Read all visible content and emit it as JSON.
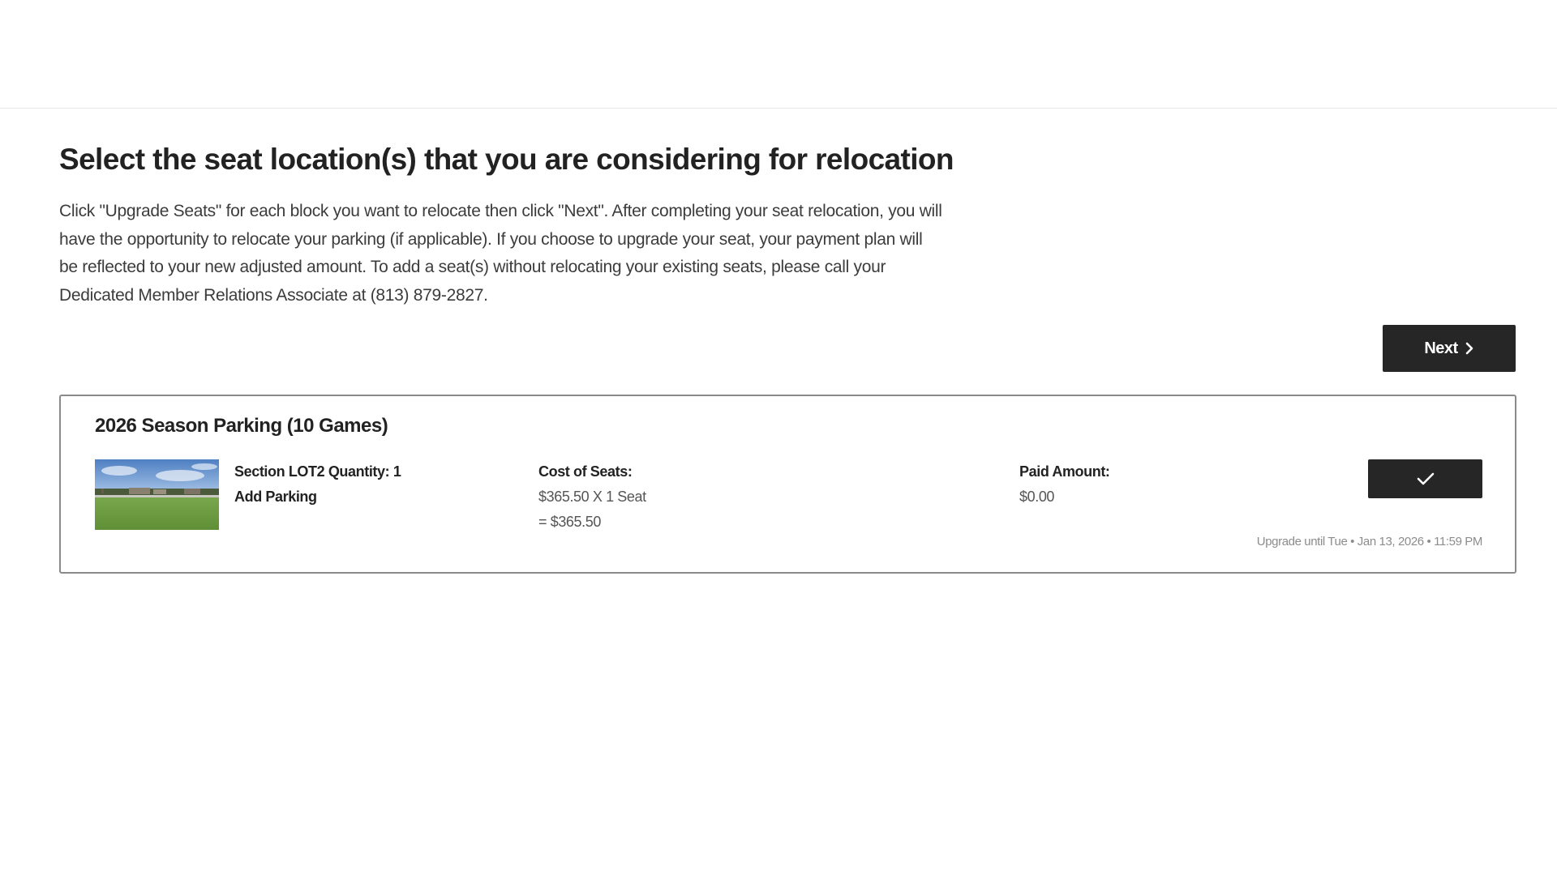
{
  "page": {
    "title": "Select the seat location(s) that you are considering for relocation",
    "instructions": "Click \"Upgrade Seats\" for each block you want to relocate then click \"Next\". After completing your seat relocation, you will have the opportunity to relocate your parking (if applicable). If you choose to upgrade your seat, your payment plan will be reflected to your new adjusted amount. To add a seat(s) without relocating your existing seats, please call your Dedicated Member Relations Associate at (813) 879-2827.",
    "next_label": "Next",
    "next_icon": "chevron-right-icon"
  },
  "block": {
    "title": "2026 Season Parking (10 Games)",
    "section_quantity": "Section LOT2 Quantity: 1",
    "add_label": "Add Parking",
    "cost_label": "Cost of Seats:",
    "cost_formula": "$365.50 X 1 Seat",
    "cost_total": "= $365.50",
    "paid_label": "Paid Amount:",
    "paid_value": "$0.00",
    "upgrade_deadline": "Upgrade until Tue • Jan 13, 2026 • 11:59 PM",
    "select_icon": "checkmark-icon",
    "thumbnail": "parking-lot-photo"
  },
  "colors": {
    "button_bg": "#262626",
    "button_text": "#ffffff",
    "card_border": "#8a8a8a",
    "header_divider": "#e8e8e8"
  }
}
